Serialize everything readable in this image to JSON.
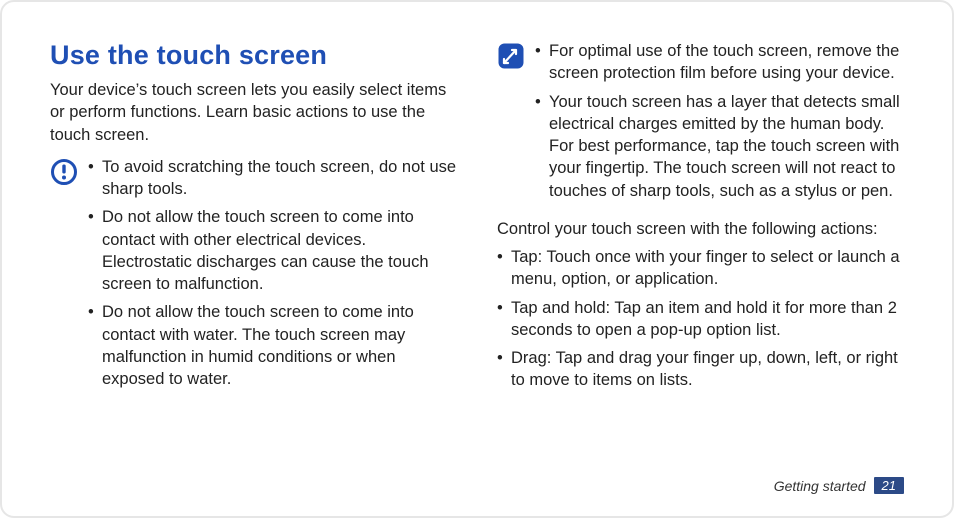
{
  "title": "Use the touch screen",
  "intro": "Your device’s touch screen lets you easily select items or perform functions. Learn basic actions to use the touch screen.",
  "caution": {
    "icon_name": "caution-icon",
    "items": [
      "To avoid scratching the touch screen, do not use sharp tools.",
      "Do not allow the touch screen to come into contact with other electrical devices. Electrostatic discharges can cause the touch screen to malfunction.",
      "Do not allow the touch screen to come into contact with water. The touch screen may malfunction in humid conditions or when exposed to water."
    ]
  },
  "tip": {
    "icon_name": "tip-icon",
    "items": [
      "For optimal use of the touch screen, remove the screen protection film before using your device.",
      "Your touch screen has a layer that detects small electrical charges emitted by the human body. For best performance, tap the touch screen with your fingertip. The touch screen will not react to touches of sharp tools, such as a stylus or pen."
    ]
  },
  "actions_intro": "Control your touch screen with the following actions:",
  "actions": [
    "Tap: Touch once with your finger to select or launch a menu, option, or application.",
    "Tap and hold: Tap an item and hold it for more than 2 seconds to open a pop-up option list.",
    "Drag: Tap and drag your finger up, down, left, or right to move to items on lists."
  ],
  "footer": {
    "section": "Getting started",
    "page": "21"
  }
}
